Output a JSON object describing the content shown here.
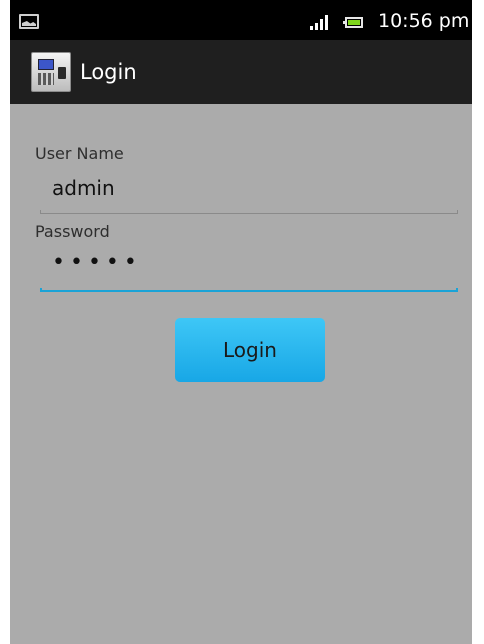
{
  "status_bar": {
    "notification_icon": "image-icon",
    "signal_icon": "signal-bars-icon",
    "battery_icon": "battery-icon",
    "time": "10:56 pm"
  },
  "action_bar": {
    "app_icon": "fingerprint-terminal-icon",
    "title": "Login"
  },
  "form": {
    "username_label": "User Name",
    "username_value": "admin",
    "password_label": "Password",
    "password_value": "•••••",
    "login_label": "Login"
  },
  "colors": {
    "background": "#ababab",
    "action_bar": "#1f1f1f",
    "accent": "#1aa3d7",
    "button": "#2bb7ee"
  }
}
